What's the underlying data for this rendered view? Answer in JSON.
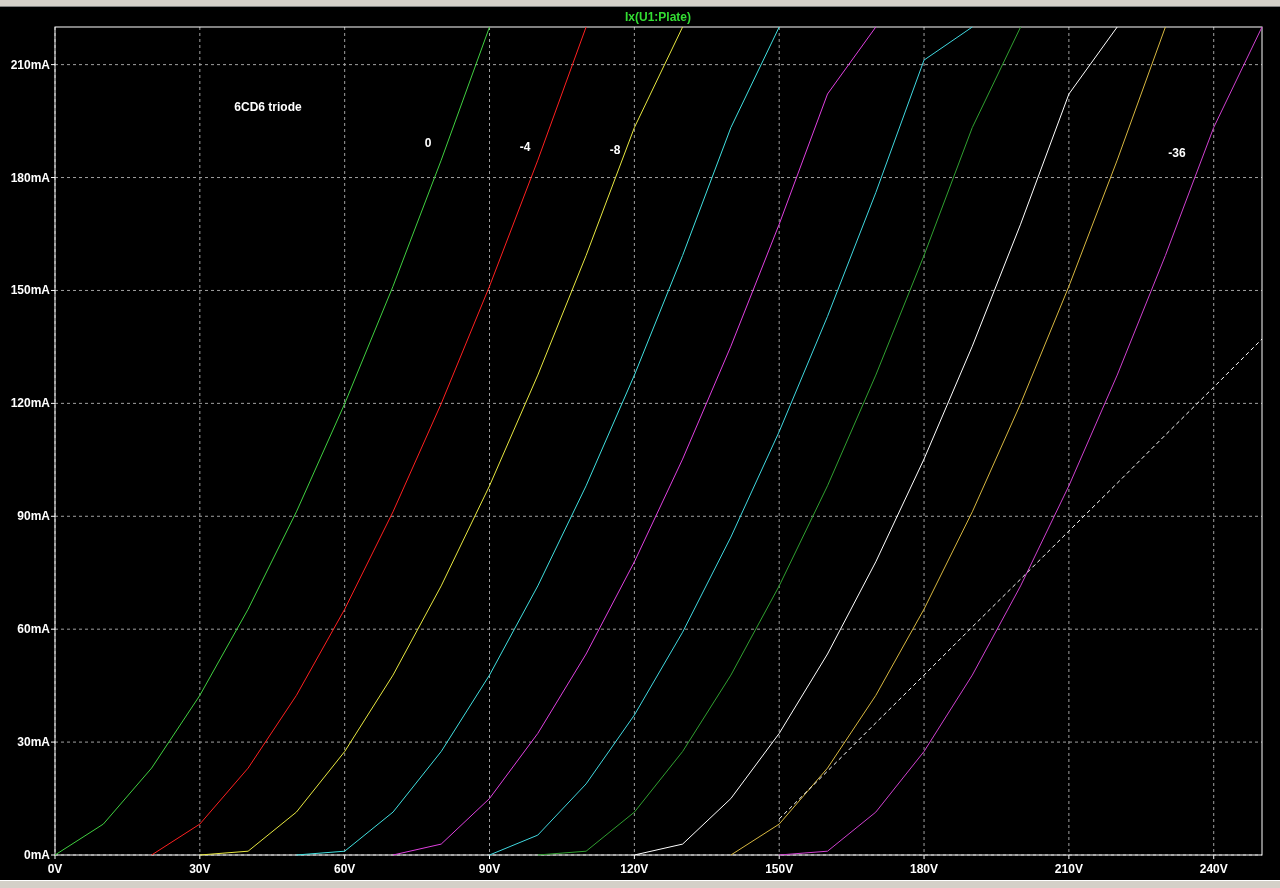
{
  "plot": {
    "trace": "Ix(U1:Plate)",
    "chart_data": {
      "type": "line",
      "xlim": [
        0,
        250
      ],
      "ylim": [
        0,
        220
      ],
      "grid": true,
      "x": [
        0,
        10,
        20,
        30,
        40,
        50,
        60,
        70,
        80,
        90,
        100,
        110,
        120,
        130,
        140,
        150,
        160,
        170,
        180,
        190,
        200,
        210,
        220,
        230,
        240,
        250
      ],
      "xticks": [
        {
          "value": 0,
          "label": "0V"
        },
        {
          "value": 30,
          "label": "30V"
        },
        {
          "value": 60,
          "label": "60V"
        },
        {
          "value": 90,
          "label": "90V"
        },
        {
          "value": 120,
          "label": "120V"
        },
        {
          "value": 150,
          "label": "150V"
        },
        {
          "value": 180,
          "label": "180V"
        },
        {
          "value": 210,
          "label": "210V"
        },
        {
          "value": 240,
          "label": "240V"
        }
      ],
      "yticks": [
        {
          "value": 0,
          "label": "0mA"
        },
        {
          "value": 30,
          "label": "30mA"
        },
        {
          "value": 60,
          "label": "60mA"
        },
        {
          "value": 90,
          "label": "90mA"
        },
        {
          "value": 120,
          "label": "120mA"
        },
        {
          "value": 150,
          "label": "150mA"
        },
        {
          "value": 180,
          "label": "180mA"
        },
        {
          "value": 210,
          "label": "210mA"
        }
      ],
      "series": [
        {
          "color": "#40d040",
          "values": [
            0,
            8.2,
            23.1,
            42.4,
            65.3,
            91.2,
            119.9,
            151.1,
            184.6,
            220,
            null,
            null,
            null,
            null,
            null,
            null,
            null,
            null,
            null,
            null,
            null,
            null,
            null,
            null,
            null,
            null
          ]
        },
        {
          "color": "#ff2020",
          "values": [
            null,
            null,
            0,
            8.2,
            23.1,
            42.4,
            65.3,
            91.2,
            119.9,
            151.1,
            184.6,
            220,
            null,
            null,
            null,
            null,
            null,
            null,
            null,
            null,
            null,
            null,
            null,
            null,
            null,
            null
          ]
        },
        {
          "color": "#e8e840",
          "values": [
            null,
            null,
            null,
            0,
            1.0,
            11.4,
            27.5,
            47.8,
            71.5,
            98.1,
            127.5,
            159.3,
            193.3,
            220,
            null,
            null,
            null,
            null,
            null,
            null,
            null,
            null,
            null,
            null,
            null,
            null
          ]
        },
        {
          "color": "#40e0e0",
          "values": [
            null,
            null,
            null,
            null,
            null,
            0,
            1.0,
            11.4,
            27.5,
            47.8,
            71.5,
            98.1,
            127.5,
            159.3,
            193.3,
            220,
            null,
            null,
            null,
            null,
            null,
            null,
            null,
            null,
            null,
            null
          ]
        },
        {
          "color": "#e040e0",
          "values": [
            null,
            null,
            null,
            null,
            null,
            null,
            null,
            0,
            2.9,
            15.0,
            32.3,
            53.4,
            77.9,
            105.2,
            135.2,
            167.6,
            202.2,
            220,
            null,
            null,
            null,
            null,
            null,
            null,
            null,
            null
          ]
        },
        {
          "color": "#40d8e0",
          "values": [
            null,
            null,
            null,
            null,
            null,
            null,
            null,
            null,
            null,
            0,
            5.3,
            18.9,
            37.2,
            59.2,
            84.5,
            112.5,
            143.1,
            176.0,
            211.2,
            220,
            null,
            null,
            null,
            null,
            null,
            null
          ]
        },
        {
          "color": "#30a030",
          "values": [
            null,
            null,
            null,
            null,
            null,
            null,
            null,
            null,
            null,
            null,
            0,
            1.0,
            11.4,
            27.5,
            47.8,
            71.5,
            98.1,
            127.5,
            159.3,
            193.3,
            220,
            null,
            null,
            null,
            null,
            null
          ]
        },
        {
          "color": "#ffffff",
          "values": [
            null,
            null,
            null,
            null,
            null,
            null,
            null,
            null,
            null,
            null,
            null,
            null,
            0,
            2.9,
            15.0,
            32.3,
            53.4,
            77.9,
            105.2,
            135.2,
            167.6,
            202.2,
            220,
            null,
            null,
            null
          ]
        },
        {
          "color": "#d8b840",
          "values": [
            null,
            null,
            null,
            null,
            null,
            null,
            null,
            null,
            null,
            null,
            null,
            null,
            null,
            null,
            0,
            8.2,
            23.1,
            42.4,
            65.3,
            91.2,
            119.9,
            151.1,
            184.6,
            220,
            null,
            null
          ]
        },
        {
          "color": "#d040d0",
          "values": [
            null,
            null,
            null,
            null,
            null,
            null,
            null,
            null,
            null,
            null,
            null,
            null,
            null,
            null,
            null,
            0,
            1.0,
            11.4,
            27.5,
            47.8,
            71.5,
            98.1,
            127.5,
            159.3,
            193.3,
            220
          ]
        },
        {
          "color": "#ffffff",
          "line_style": "dashed",
          "values": [
            null,
            null,
            null,
            null,
            null,
            null,
            null,
            null,
            null,
            null,
            null,
            null,
            null,
            null,
            null,
            9.6,
            22.3,
            35.1,
            47.8,
            60.6,
            73.3,
            86.1,
            98.8,
            111.6,
            124.3,
            137.1
          ]
        }
      ],
      "annotations": [
        "6CD6 triode",
        "0",
        "-4",
        "-8",
        "-36"
      ]
    }
  }
}
